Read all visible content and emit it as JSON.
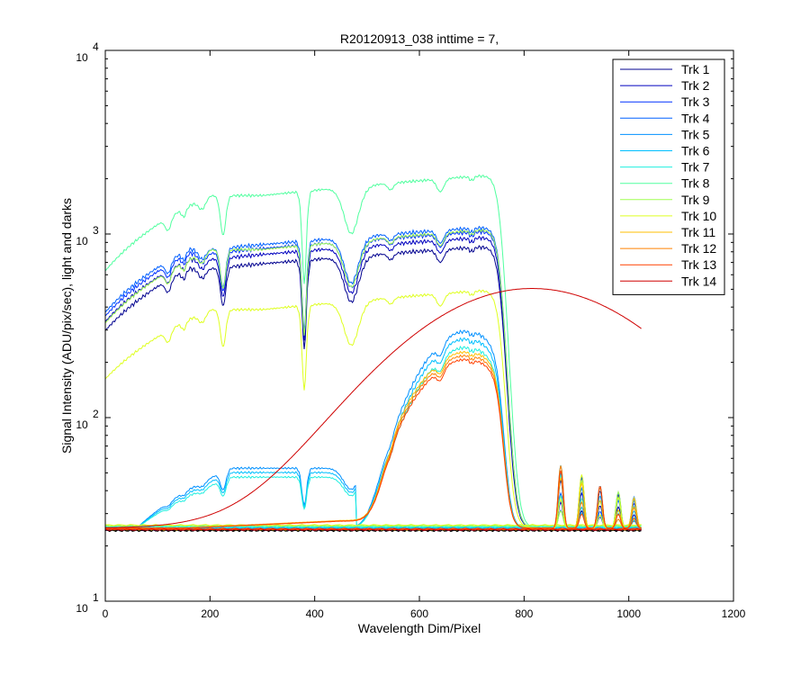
{
  "chart_data": {
    "type": "line",
    "title": "R20120913_038 inttime = 7,",
    "xlabel": "Wavelength Dim/Pixel",
    "ylabel": "Signal Intensity (ADU/pix/sec), light and darks",
    "xlim": [
      0,
      1200
    ],
    "ylim": [
      10,
      10000
    ],
    "yscale": "log",
    "grid": false,
    "legend_position": "top-right",
    "x_ticks": [
      0,
      200,
      400,
      600,
      800,
      1000,
      1200
    ],
    "x_tick_labels": [
      "0",
      "200",
      "400",
      "600",
      "800",
      "1000",
      "1200"
    ],
    "y_ticks": [
      10,
      100,
      1000,
      10000
    ],
    "y_tick_labels": [
      {
        "base": "10",
        "exp": "1"
      },
      {
        "base": "10",
        "exp": "2"
      },
      {
        "base": "10",
        "exp": "3"
      },
      {
        "base": "10",
        "exp": "4"
      }
    ],
    "series": [
      {
        "name": "Trk 1",
        "color": "#00008f",
        "kind": "bright",
        "scale": 0.78,
        "dark": 24.5
      },
      {
        "name": "Trk 2",
        "color": "#0000bf",
        "kind": "bright",
        "scale": 0.88,
        "dark": 24.6
      },
      {
        "name": "Trk 3",
        "color": "#0030ff",
        "kind": "bright",
        "scale": 0.95,
        "dark": 24.7
      },
      {
        "name": "Trk 4",
        "color": "#0060ff",
        "kind": "bright",
        "scale": 1.0,
        "dark": 24.8
      },
      {
        "name": "Trk 5",
        "color": "#0090ff",
        "kind": "mid",
        "scale": 1.0,
        "dark": 25.0
      },
      {
        "name": "Trk 6",
        "color": "#00bfff",
        "kind": "mid",
        "scale": 0.9,
        "dark": 25.2
      },
      {
        "name": "Trk 7",
        "color": "#20efdf",
        "kind": "mid",
        "scale": 0.8,
        "dark": 25.4
      },
      {
        "name": "Trk 8",
        "color": "#50ff9f",
        "kind": "bright2",
        "scale": 1.1,
        "dark": 25.6
      },
      {
        "name": "Trk 9",
        "color": "#9fff50",
        "kind": "bright2",
        "scale": 0.55,
        "dark": 25.8
      },
      {
        "name": "Trk 10",
        "color": "#dfff20",
        "kind": "bright2",
        "scale": 0.25,
        "dark": 26.0
      },
      {
        "name": "Trk 11",
        "color": "#ffbf00",
        "kind": "low",
        "scale": 1.0,
        "dark": 24.6
      },
      {
        "name": "Trk 12",
        "color": "#ff8000",
        "kind": "low",
        "scale": 0.95,
        "dark": 24.7
      },
      {
        "name": "Trk 13",
        "color": "#ff4000",
        "kind": "low",
        "scale": 0.9,
        "dark": 24.8
      },
      {
        "name": "Trk 14",
        "color": "#cf0000",
        "kind": "smooth",
        "scale": 1.0,
        "dark": 24.5
      }
    ]
  }
}
